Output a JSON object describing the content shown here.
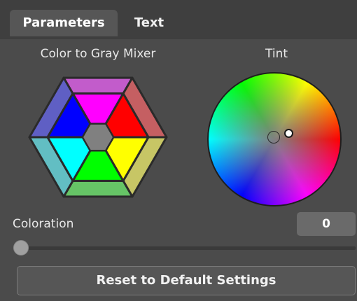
{
  "tabs": {
    "parameters_label": "Parameters",
    "text_label": "Text",
    "active": "Parameters"
  },
  "mixer": {
    "title": "Color to Gray Mixer",
    "inner_segments": [
      {
        "name": "magenta",
        "color": "#ff00ff"
      },
      {
        "name": "red",
        "color": "#ff0000"
      },
      {
        "name": "yellow",
        "color": "#ffff00"
      },
      {
        "name": "green",
        "color": "#00ff00"
      },
      {
        "name": "cyan",
        "color": "#00ffff"
      },
      {
        "name": "blue",
        "color": "#0000ff"
      }
    ],
    "outer_segments": [
      {
        "name": "magenta-outer",
        "color": "#c25ccb"
      },
      {
        "name": "red-outer",
        "color": "#c55f62"
      },
      {
        "name": "yellow-outer",
        "color": "#c7c665"
      },
      {
        "name": "green-outer",
        "color": "#66c466"
      },
      {
        "name": "cyan-outer",
        "color": "#62bec3"
      },
      {
        "name": "blue-outer",
        "color": "#5f5fc4"
      }
    ],
    "center_color": "#808080"
  },
  "tint": {
    "title": "Tint"
  },
  "coloration": {
    "label": "Coloration",
    "value": "0",
    "slider_fraction": 0
  },
  "reset_button": {
    "label": "Reset to Default Settings"
  }
}
